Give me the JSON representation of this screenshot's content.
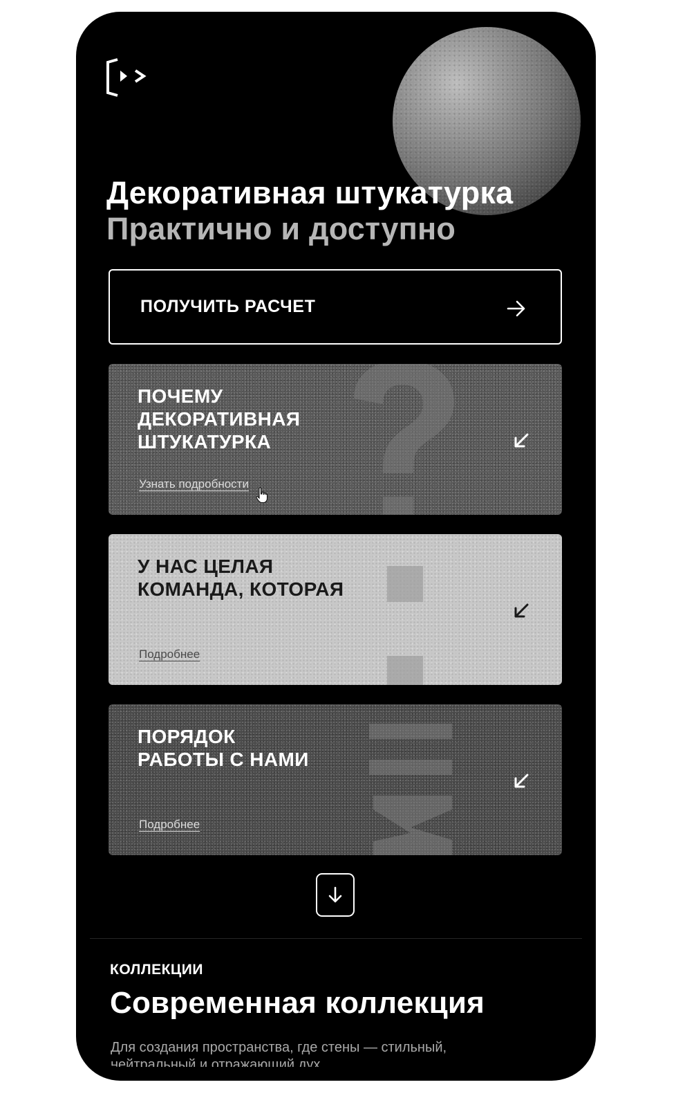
{
  "hero": {
    "title": "Декоративная штукатурка",
    "subtitle": "Практично и доступно"
  },
  "cta": {
    "label": "ПОЛУЧИТЬ РАСЧЕТ",
    "icon": "arrow-right-icon"
  },
  "cards": [
    {
      "title_lines": [
        "ПОЧЕМУ",
        "ДЕКОРАТИВНАЯ",
        "ШТУКАТУРКА"
      ],
      "link": "Узнать подробности",
      "icon": "arrow-down-left-icon",
      "background": "#595959",
      "decoration": "question-mark"
    },
    {
      "title_lines": [
        "У НАС ЦЕЛАЯ",
        "КОМАНДА, КОТОРАЯ"
      ],
      "link": "Подробнее",
      "icon": "arrow-down-left-icon",
      "background": "#c8c8c8",
      "decoration": "ellipsis"
    },
    {
      "title_lines": [
        "ПОРЯДОК",
        "РАБОТЫ С НАМИ"
      ],
      "link": "Подробнее",
      "icon": "arrow-down-left-icon",
      "background": "#4b4b4b",
      "decoration": "number-3"
    }
  ],
  "scroll": {
    "icon": "arrow-down-icon"
  },
  "collections": {
    "eyebrow": "КОЛЛЕКЦИИ",
    "title": "Современная коллекция",
    "description": "Для создания пространства, где стены — стильный, нейтральный и отражающий дух"
  },
  "colors": {
    "background": "#000000",
    "text": "#ffffff",
    "muted": "#b6b6b6"
  }
}
